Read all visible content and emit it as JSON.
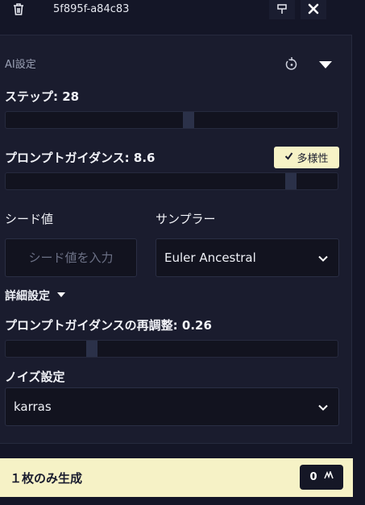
{
  "topbar": {
    "title": "5f895f-a84c83",
    "icons": {
      "delete": "trash-icon",
      "pin": "pin-icon",
      "close": "close-icon"
    }
  },
  "ai_settings": {
    "section_title": "AI設定",
    "icons": {
      "reset": "reset-icon",
      "collapse": "collapse-icon"
    },
    "steps": {
      "label": "ステップ:",
      "value": "28",
      "fraction": 0.55
    },
    "guidance": {
      "label": "プロンプトガイダンス:",
      "value": "8.6",
      "fraction": 0.86,
      "chip_label": "多様性"
    },
    "seed": {
      "label": "シード値",
      "placeholder": "シード値を入力",
      "value": ""
    },
    "sampler": {
      "label": "サンプラー",
      "selected": "Euler Ancestral"
    },
    "advanced": {
      "label": "詳細設定"
    },
    "guidance_rescale": {
      "label": "プロンプトガイダンスの再調整:",
      "value": "0.26",
      "fraction": 0.26
    },
    "noise": {
      "label": "ノイズ設定",
      "selected": "karras"
    }
  },
  "generate": {
    "label": "１枚のみ生成",
    "cost": "0"
  },
  "colors": {
    "background": "#141627",
    "panel": "#1a1c2e",
    "accent": "#f6f2c6"
  }
}
